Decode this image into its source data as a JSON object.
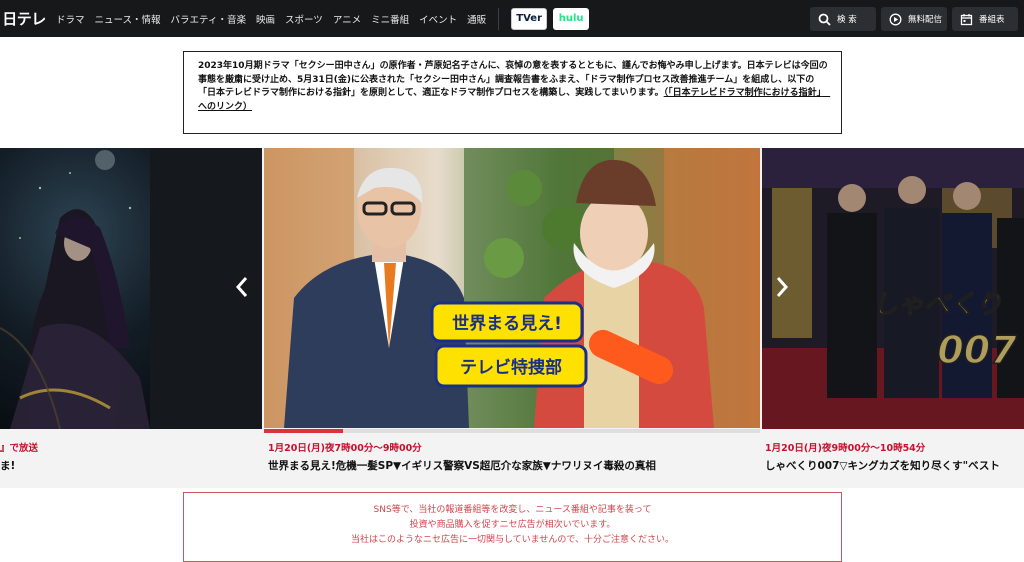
{
  "header": {
    "logo": "日テレ",
    "nav": [
      "ドラマ",
      "ニュース・情報",
      "バラエティ・音楽",
      "映画",
      "スポーツ",
      "アニメ",
      "ミニ番組",
      "イベント",
      "通販"
    ],
    "services": {
      "tver": "TVer",
      "hulu": "hulu"
    },
    "buttons": {
      "search": "検 索",
      "free": "無料配信",
      "guide": "番組表"
    }
  },
  "notice": {
    "text": "2023年10月期ドラマ「セクシー田中さん」の原作者・芦原妃名子さんに、哀悼の意を表するとともに、謹んでお悔やみ申し上げます。日本テレビは今回の事態を厳粛に受け止め、5月31日(金)に公表された「セクシー田中さん」調査報告書をふまえ、「ドラマ制作プロセス改善推進チーム」を組成し、以下の「日本テレビドラマ制作における指針」を原則として、適正なドラマ制作プロセスを構築し、実践してまいります。",
    "link": "（「日本テレビドラマ制作における指針」　へのリンク）"
  },
  "carousel": {
    "progress": 0.16,
    "left": {
      "date": "』で放送",
      "title": "ま!"
    },
    "center": {
      "date": "1月20日(月)夜7時00分～9時00分",
      "title": "世界まる見え!危機一髪SP▼イギリス警察VS超厄介な家族▼ナワリヌイ毒殺の真相",
      "logo_lines": [
        "世界まる見え!",
        "テレビ特捜部"
      ]
    },
    "right": {
      "date": "1月20日(月)夜9時00分～10時54分",
      "title": "しゃべくり007▽キングカズを知り尽くす\"ベスト",
      "logo_lines": [
        "しゃべくり",
        "007"
      ]
    }
  },
  "warning": {
    "lines": [
      "SNS等で、当社の報道番組等を改変し、ニュース番組や記事を装って",
      "投資や商品購入を促すニセ広告が相次いでいます。",
      "当社はこのようなニセ広告に一切関与していませんので、十分ご注意ください。"
    ]
  }
}
